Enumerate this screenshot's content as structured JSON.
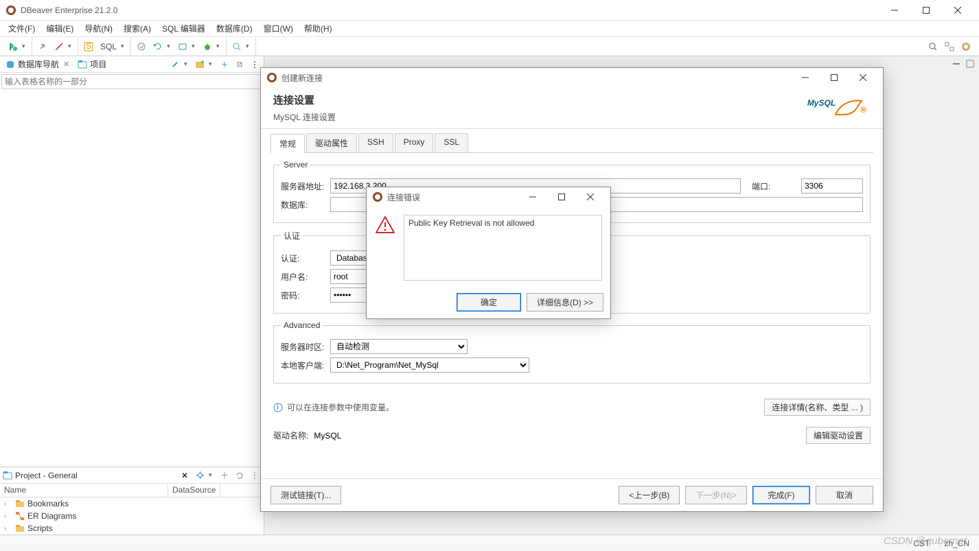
{
  "app": {
    "title": "DBeaver Enterprise 21.2.0"
  },
  "menu": {
    "file": "文件(F)",
    "edit": "编辑(E)",
    "navigate": "导航(N)",
    "search": "搜索(A)",
    "sql_editor": "SQL 编辑器",
    "database": "数据库(D)",
    "window": "窗口(W)",
    "help": "帮助(H)"
  },
  "toolbar": {
    "sql_label": "SQL"
  },
  "views": {
    "db_nav": "数据库导航",
    "projects": "项目",
    "filter_placeholder": "输入表格名称的一部分"
  },
  "project_panel": {
    "title": "Project - General",
    "col_name": "Name",
    "col_ds": "DataSource",
    "items": [
      {
        "label": "Bookmarks",
        "color": "#d99a2b"
      },
      {
        "label": "ER Diagrams",
        "color": "#c36f1f"
      },
      {
        "label": "Scripts",
        "color": "#d99a2b"
      }
    ]
  },
  "status": {
    "tz": "CST",
    "locale": "zh_CN",
    "watermark": "CSDN @qubernet"
  },
  "dialog": {
    "title": "创建新连接",
    "heading": "连接设置",
    "subheading": "MySQL 连接设置",
    "logo_text": "MySQL",
    "tabs": {
      "general": "常规",
      "driver_props": "驱动属性",
      "ssh": "SSH",
      "proxy": "Proxy",
      "ssl": "SSL"
    },
    "server": {
      "legend": "Server",
      "host_label": "服务器地址:",
      "host_value": "192.168.3.200",
      "port_label": "端口:",
      "port_value": "3306",
      "database_label": "数据库:",
      "database_value": ""
    },
    "auth": {
      "legend": "认证",
      "method_label": "认证:",
      "method_value": "Database Native",
      "user_label": "用户名:",
      "user_value": "root",
      "pass_label": "密码:",
      "pass_value": "••••••"
    },
    "advanced": {
      "legend": "Advanced",
      "tz_label": "服务器时区:",
      "tz_value": "自动检测",
      "local_client_label": "本地客户端:",
      "local_client_value": "D:\\Net_Program\\Net_MySql"
    },
    "info_text": "可以在连接参数中使用变量。",
    "conn_details_btn": "连接详情(名称、类型 ... )",
    "driver_label": "驱动名称:",
    "driver_value": "MySQL",
    "edit_driver_btn": "编辑驱动设置",
    "footer": {
      "test": "测试链接(T)...",
      "back": "<上一步(B)",
      "next": "下一步(N)>",
      "finish": "完成(F)",
      "cancel": "取消"
    }
  },
  "error": {
    "title": "连接错误",
    "message": "Public Key Retrieval is not allowed",
    "ok": "确定",
    "details": "详细信息(D) >>"
  }
}
